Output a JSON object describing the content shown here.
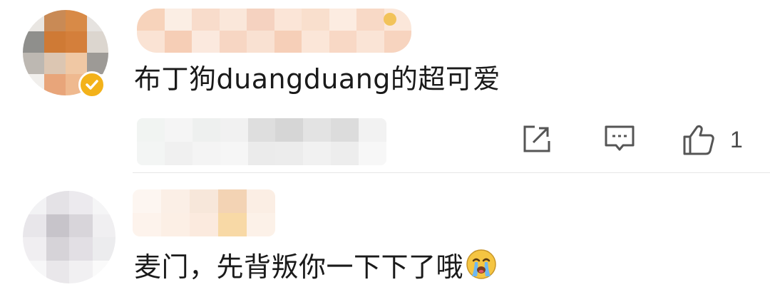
{
  "comments": [
    {
      "username": "",
      "verified": true,
      "text": "布丁狗duangduang的超可爱",
      "actions": {
        "share_icon": "share-icon",
        "reply_icon": "reply-icon",
        "like_icon": "thumbs-up-icon",
        "like_count": "1"
      }
    },
    {
      "username": "",
      "text": "麦门，先背叛你一下下了哦",
      "emoji": "crying-face-emoji"
    }
  ],
  "colors": {
    "verified": "#f3b21a",
    "text": "#1a1a1a",
    "icon": "#555555",
    "divider": "#e6e6e6"
  }
}
